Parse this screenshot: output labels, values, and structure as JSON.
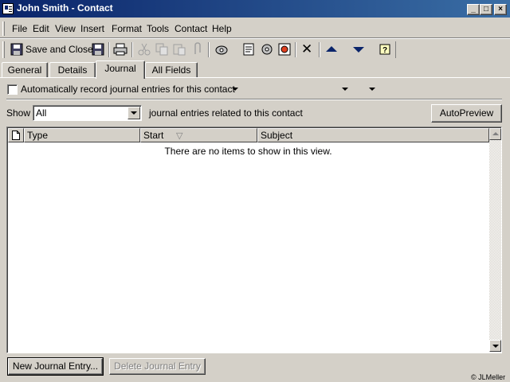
{
  "window": {
    "title": "John Smith - Contact",
    "controls": {
      "minimize": "_",
      "maximize": "□",
      "close": "×"
    }
  },
  "menu": [
    "File",
    "Edit",
    "View",
    "Insert",
    "Format",
    "Tools",
    "Contact",
    "Help"
  ],
  "toolbar": {
    "save_and_close": "Save and Close",
    "icons": [
      "save-icon",
      "print-icon",
      "cut-icon",
      "copy-icon",
      "paste-icon",
      "attach-icon",
      "new-message-icon",
      "properties-icon",
      "categories-icon",
      "flag-icon",
      "delete-icon",
      "previous-item-icon",
      "next-item-icon",
      "help-icon"
    ],
    "delete_glyph": "✕"
  },
  "tabs": [
    "General",
    "Details",
    "Journal",
    "All Fields"
  ],
  "active_tab": "Journal",
  "journal": {
    "auto_record_label": "Automatically record journal entries for this contact",
    "auto_record_checked": false,
    "show_label": "Show",
    "show_value": "All",
    "related_label": "journal entries related to this contact",
    "autopreview_label": "AutoPreview",
    "columns": [
      "Type",
      "Start",
      "Subject"
    ],
    "sorted_column_glyph": "▽",
    "empty_message": "There are no items to show in this view.",
    "new_entry_label": "New Journal Entry...",
    "delete_entry_label": "Delete Journal Entry"
  },
  "footer": {
    "credit": "© JLMeller"
  },
  "colors": {
    "title_gradient_start": "#0a246a",
    "title_gradient_end": "#3a6ea5",
    "face": "#d4d0c8"
  }
}
